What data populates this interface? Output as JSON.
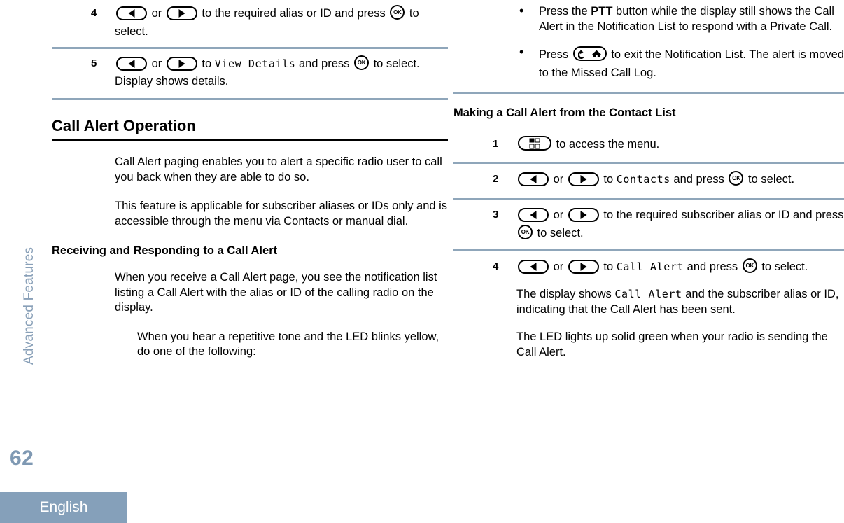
{
  "page": {
    "number": "62",
    "language": "English",
    "chapter": "Advanced Features"
  },
  "icons": {
    "left_arrow": "left-arrow-key-icon",
    "right_arrow": "right-arrow-key-icon",
    "ok": "ok-key-icon",
    "ok_label": "OK",
    "back_home": "back-home-key-icon",
    "menu": "menu-key-icon"
  },
  "left_column": {
    "steps": [
      {
        "number": "4",
        "t1": " or ",
        "t2": " to the required alias or ID and press ",
        "t3": " to select."
      },
      {
        "number": "5",
        "t1": " or ",
        "t2": " to ",
        "display": "View Details",
        "t3": " and press ",
        "t4": " to select.",
        "extra": "Display shows details."
      }
    ],
    "section": {
      "heading": "Call Alert Operation",
      "para1": "Call Alert paging enables you to alert a specific radio user to call you back when they are able to do so.",
      "para2": "This feature is applicable for subscriber aliases or IDs only and is accessible through the menu via Contacts or manual dial.",
      "subheading": "Receiving and Responding to a Call Alert",
      "para3": "When you receive a Call Alert page, you see the notification list listing a Call Alert with the alias or ID of the calling radio on the display.",
      "para4": "When you hear a repetitive tone and the LED blinks yellow, do one of the following:"
    }
  },
  "right_column": {
    "bullets": [
      {
        "pre": "Press the ",
        "bold": "PTT",
        "post": " button while the display still shows the Call Alert in the Notification List to respond with a Private Call."
      },
      {
        "pre": "Press ",
        "post": " to exit the Notification List. The alert is moved to the Missed Call Log."
      }
    ],
    "subheading": "Making a Call Alert from the Contact List",
    "steps": [
      {
        "number": "1",
        "t1": " to access the menu."
      },
      {
        "number": "2",
        "t1": " or ",
        "t2": " to ",
        "display": "Contacts",
        "t3": " and press ",
        "t4": " to select."
      },
      {
        "number": "3",
        "t1": " or ",
        "t2": " to the required subscriber alias or ID and press ",
        "t3": " to select."
      },
      {
        "number": "4",
        "t1": " or ",
        "t2": " to ",
        "display": "Call Alert",
        "t3": " and press ",
        "t4": " to select.",
        "result1_pre": "The display shows ",
        "result1_display": "Call Alert",
        "result1_post": " and the subscriber alias or ID, indicating that the Call Alert has been sent.",
        "result2": "The LED lights up solid green when your radio is sending the Call Alert."
      }
    ]
  },
  "colors": {
    "accent": "#85a0ba",
    "separator": "#8fa6ba",
    "page_number": "#7f99b3",
    "chapter_label": "#89a0b8"
  }
}
